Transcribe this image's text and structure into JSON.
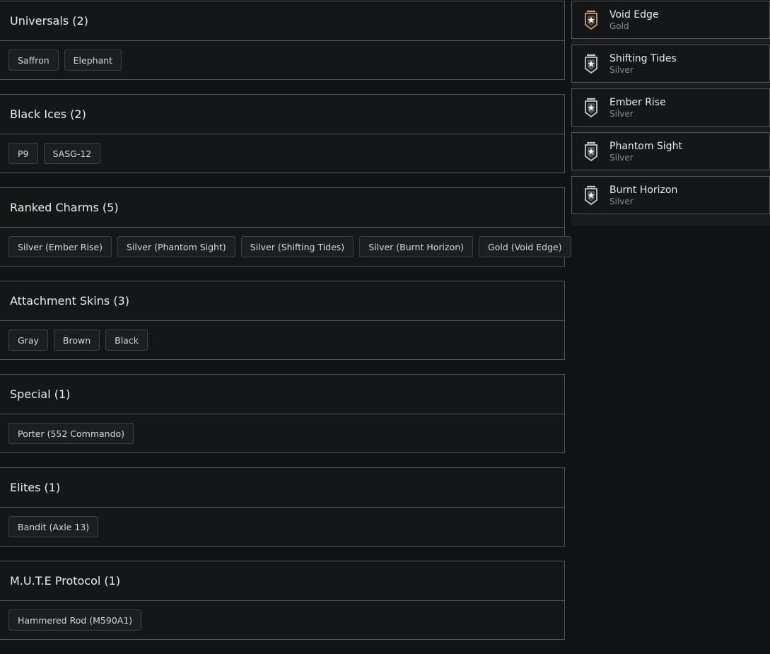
{
  "sections": [
    {
      "title": "Universals (2)",
      "items": [
        "Saffron",
        "Elephant"
      ]
    },
    {
      "title": "Black Ices (2)",
      "items": [
        "P9",
        "SASG-12"
      ]
    },
    {
      "title": "Ranked Charms (5)",
      "items": [
        "Silver (Ember Rise)",
        "Silver (Phantom Sight)",
        "Silver (Shifting Tides)",
        "Silver (Burnt Horizon)",
        "Gold (Void Edge)"
      ]
    },
    {
      "title": "Attachment Skins (3)",
      "items": [
        "Gray",
        "Brown",
        "Black"
      ]
    },
    {
      "title": "Special (1)",
      "items": [
        "Porter (552 Commando)"
      ]
    },
    {
      "title": "Elites (1)",
      "items": [
        "Bandit (Axle 13)"
      ]
    },
    {
      "title": "M.U.T.E Protocol (1)",
      "items": [
        "Hammered Rod (M590A1)"
      ]
    }
  ],
  "charms": [
    {
      "name": "Void Edge",
      "tier": "Gold",
      "icon": "gold-charm-banner-icon",
      "color": "#c9a066"
    },
    {
      "name": "Shifting Tides",
      "tier": "Silver",
      "icon": "silver-charm-banner-icon",
      "color": "#c8c8c8"
    },
    {
      "name": "Ember Rise",
      "tier": "Silver",
      "icon": "silver-charm-banner-icon",
      "color": "#c8c8c8"
    },
    {
      "name": "Phantom Sight",
      "tier": "Silver",
      "icon": "silver-charm-banner-icon",
      "color": "#c8c8c8"
    },
    {
      "name": "Burnt Horizon",
      "tier": "Silver",
      "icon": "silver-charm-banner-icon",
      "color": "#c8c8c8"
    }
  ]
}
